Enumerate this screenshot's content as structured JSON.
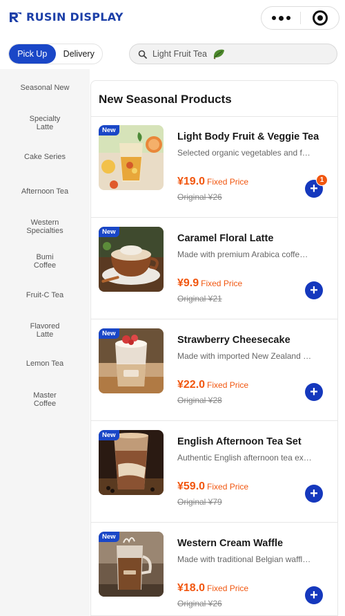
{
  "app": {
    "brand": "RUSIN DISPLAY"
  },
  "capsule": {
    "more_icon": "more-dots-icon",
    "close_icon": "target-close-icon"
  },
  "order_mode": {
    "options": [
      "Pick Up",
      "Delivery"
    ],
    "selected": "Pick Up"
  },
  "search": {
    "placeholder": "Light Fruit Tea",
    "icon": "search-icon",
    "leaf_icon": "leaf-icon"
  },
  "categories": [
    "Seasonal New",
    "Specialty Latte",
    "Cake Series",
    "Afternoon Tea",
    "Western Specialties",
    "Bumi Coffee",
    "Fruit-C Tea",
    "Flavored Latte",
    "Lemon Tea",
    "Master Coffee"
  ],
  "section": {
    "title": "New Seasonal Products"
  },
  "products": [
    {
      "badge": "New",
      "name": "Light Body Fruit & Veggie Tea",
      "desc": "Selected organic vegetables and fruits",
      "price": "¥19.0",
      "price_label": "Fixed Price",
      "original": "Original ¥26",
      "cart_count": "1"
    },
    {
      "badge": "New",
      "name": "Caramel Floral Latte",
      "desc": "Made with premium Arabica coffee beans",
      "price": "¥9.9",
      "price_label": "Fixed Price",
      "original": "Original ¥21"
    },
    {
      "badge": "New",
      "name": "Strawberry Cheesecake",
      "desc": "Made with imported New Zealand cream cheese",
      "price": "¥22.0",
      "price_label": "Fixed Price",
      "original": "Original ¥28"
    },
    {
      "badge": "New",
      "name": "English Afternoon Tea Set",
      "desc": "Authentic English afternoon tea experience",
      "price": "¥59.0",
      "price_label": "Fixed Price",
      "original": "Original ¥79"
    },
    {
      "badge": "New",
      "name": "Western Cream Waffle",
      "desc": "Made with traditional Belgian waffle batter",
      "price": "¥18.0",
      "price_label": "Fixed Price",
      "original": "Original ¥26"
    }
  ],
  "colors": {
    "brand_blue": "#1a47c7",
    "accent_orange": "#f1560f"
  }
}
